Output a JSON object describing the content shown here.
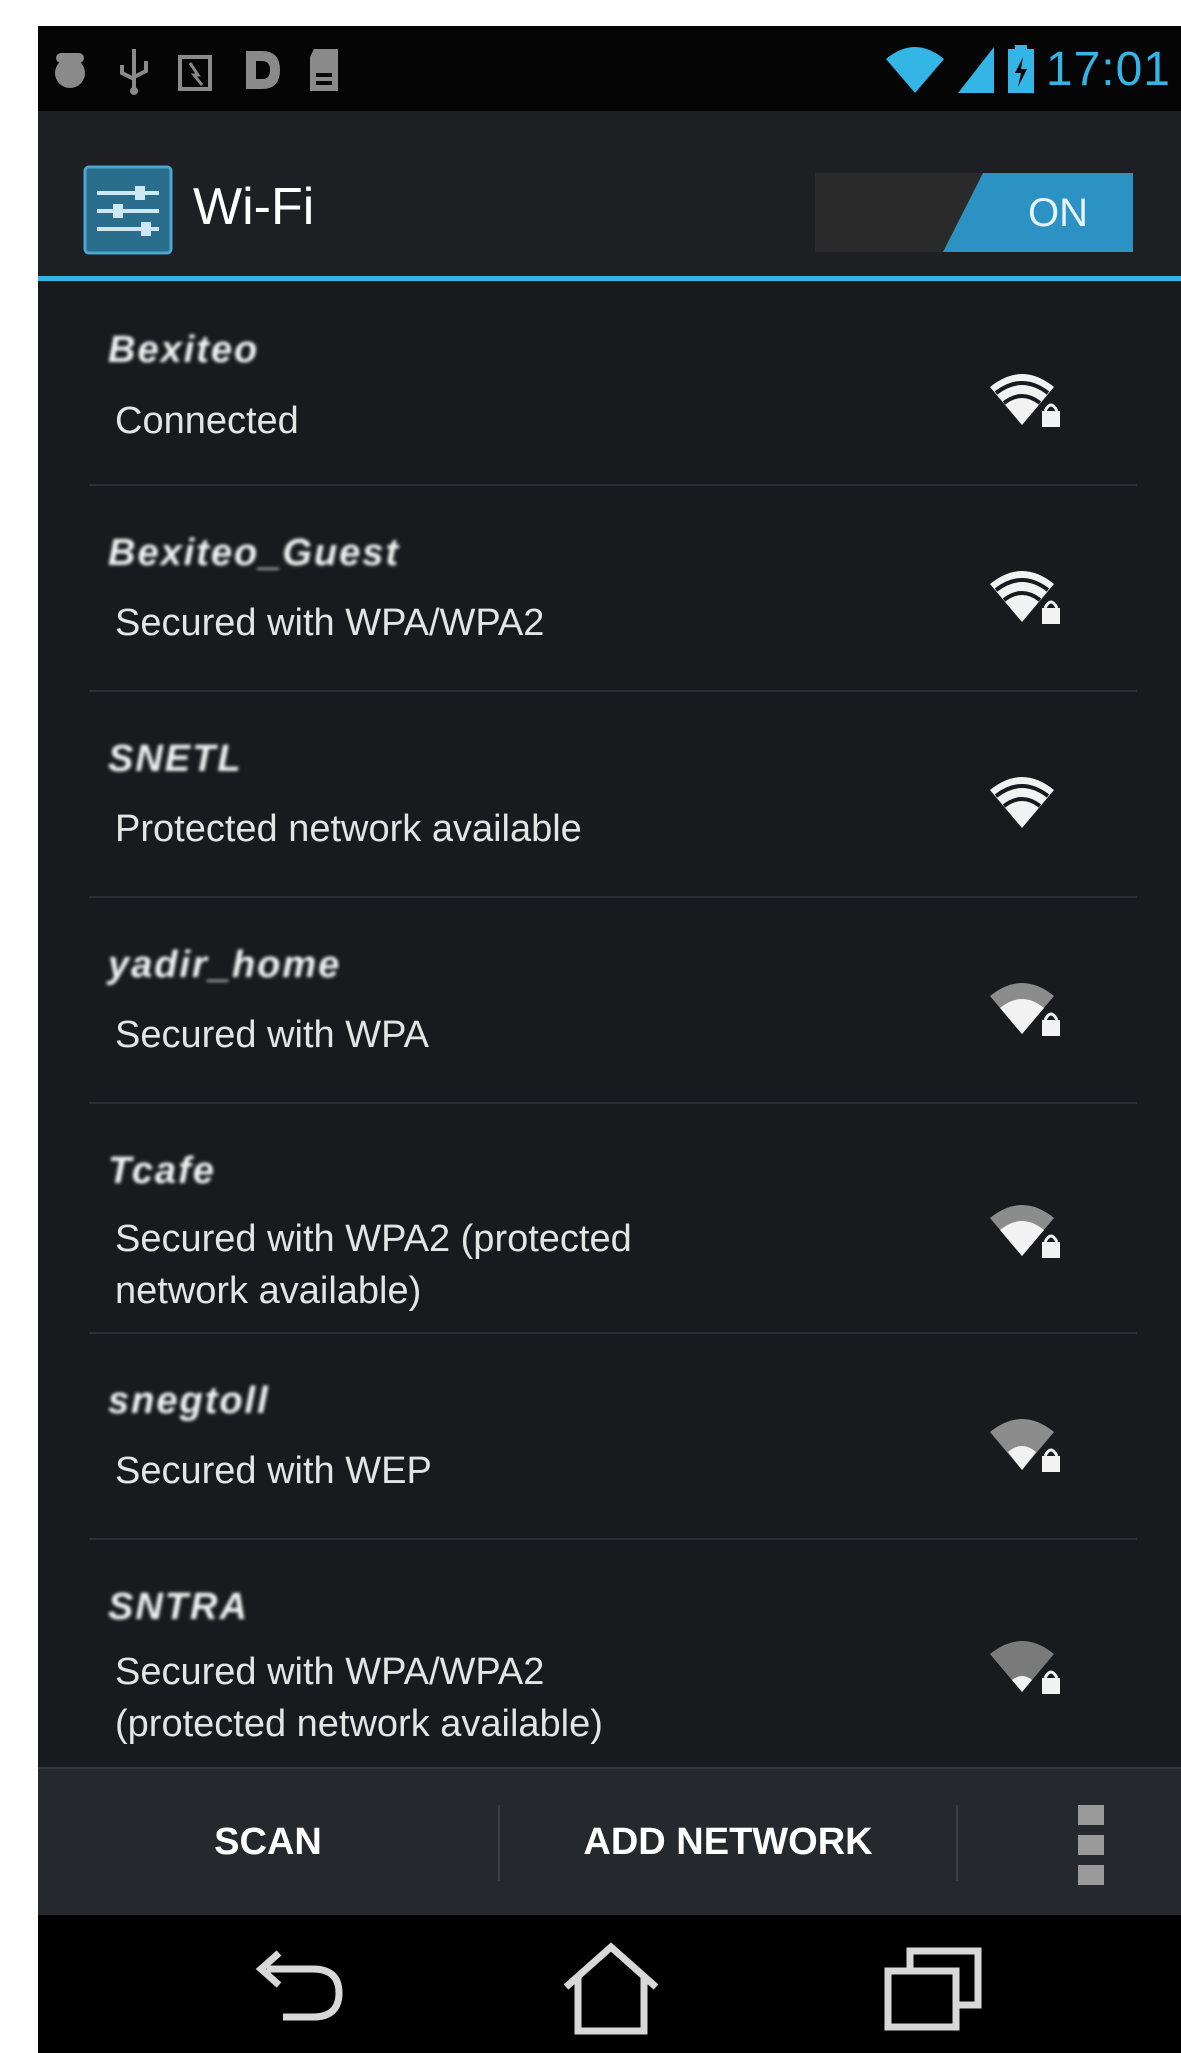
{
  "status_bar": {
    "time": "17:01",
    "left_icons": [
      "android-debug-icon",
      "usb-icon",
      "battery-widget-icon",
      "d-app-icon",
      "sd-card-icon"
    ],
    "right_icons": [
      "wifi-status-icon",
      "cell-signal-icon",
      "battery-charging-icon"
    ],
    "accent_color": "#33b5e5"
  },
  "action_bar": {
    "title": "Wi-Fi",
    "toggle_label": "ON",
    "toggle_color": "#2c92c4"
  },
  "networks": [
    {
      "ssid": "Bexiteo",
      "status": "Connected",
      "signal": "full",
      "locked": true
    },
    {
      "ssid": "Bexiteo_Guest",
      "status": "Secured with WPA/WPA2",
      "signal": "full",
      "locked": true
    },
    {
      "ssid": "SNETL",
      "status": "Protected network available",
      "signal": "full",
      "locked": false
    },
    {
      "ssid": "yadir_home",
      "status": "Secured with WPA",
      "signal": "strong",
      "locked": true
    },
    {
      "ssid": "Tcafe",
      "status": "Secured with WPA2 (protected network available)",
      "signal": "strong",
      "locked": true
    },
    {
      "ssid": "snegtoll",
      "status": "Secured with WEP",
      "signal": "medium",
      "locked": true
    },
    {
      "ssid": "SNTRA",
      "status": "Secured with WPA/WPA2 (protected network available)",
      "signal": "weak",
      "locked": true
    }
  ],
  "button_bar": {
    "scan_label": "SCAN",
    "add_network_label": "ADD NETWORK",
    "overflow_icon": "overflow-menu-icon"
  },
  "nav_bar": {
    "icons": [
      "back-icon",
      "home-icon",
      "recent-apps-icon"
    ]
  }
}
